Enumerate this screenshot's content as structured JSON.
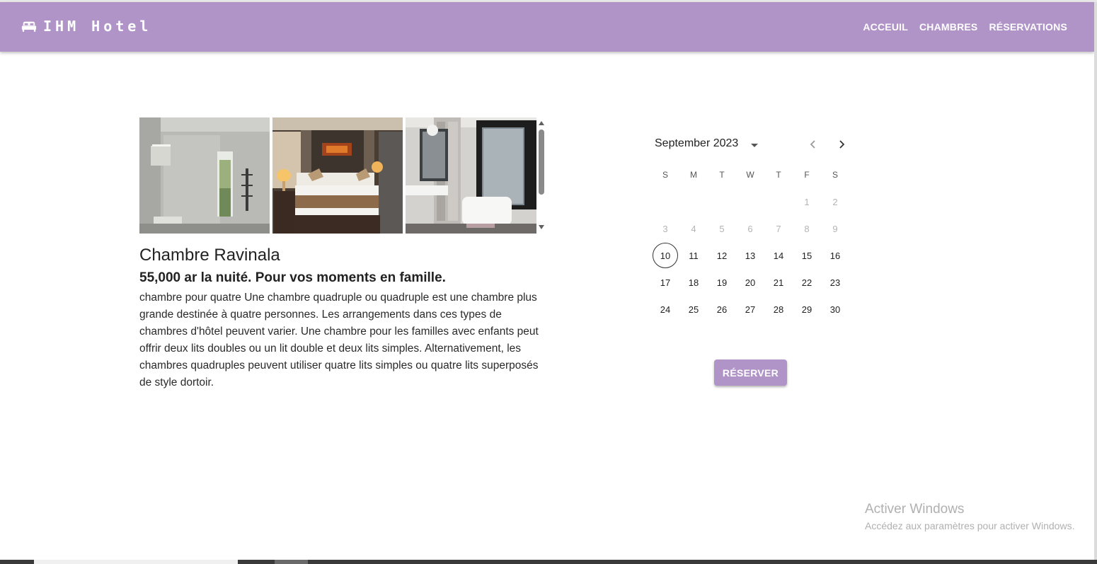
{
  "header": {
    "brand": "IHM Hotel",
    "brand_icon": "bed-icon",
    "bar_color": "#b094c8",
    "nav": [
      {
        "label": "ACCEUIL"
      },
      {
        "label": "CHAMBRES"
      },
      {
        "label": "RÉSERVATIONS"
      }
    ]
  },
  "room": {
    "title": "Chambre Ravinala",
    "price_line": "55,000 ar la nuité. Pour vos moments en famille.",
    "description": "chambre pour quatre Une chambre quadruple ou quadruple est une chambre plus grande destinée à quatre personnes. Les arrangements dans ces types de chambres d'hôtel peuvent varier. Une chambre pour les familles avec enfants peut offrir deux lits doubles ou un lit double et deux lits simples. Alternativement, les chambres quadruples peuvent utiliser quatre lits simples ou quatre lits superposés de style dortoir.",
    "photos": [
      "bathroom-shower-photo",
      "bedroom-photo",
      "bathroom-bathtub-photo"
    ]
  },
  "calendar": {
    "month_label": "September 2023",
    "weekdays": [
      "S",
      "M",
      "T",
      "W",
      "T",
      "F",
      "S"
    ],
    "weeks": [
      [
        "",
        "",
        "",
        "",
        "",
        "1",
        "2"
      ],
      [
        "3",
        "4",
        "5",
        "6",
        "7",
        "8",
        "9"
      ],
      [
        "10",
        "11",
        "12",
        "13",
        "14",
        "15",
        "16"
      ],
      [
        "17",
        "18",
        "19",
        "20",
        "21",
        "22",
        "23"
      ],
      [
        "24",
        "25",
        "26",
        "27",
        "28",
        "29",
        "30"
      ]
    ],
    "disabled_days": [
      "1",
      "2",
      "3",
      "4",
      "5",
      "6",
      "7",
      "8",
      "9"
    ],
    "today": "10",
    "prev_icon": "chevron-left-icon",
    "next_icon": "chevron-right-icon"
  },
  "actions": {
    "reserve_label": "RÉSERVER"
  },
  "windows_notice": {
    "title": "Activer Windows",
    "subtitle": "Accédez aux paramètres pour activer Windows."
  }
}
